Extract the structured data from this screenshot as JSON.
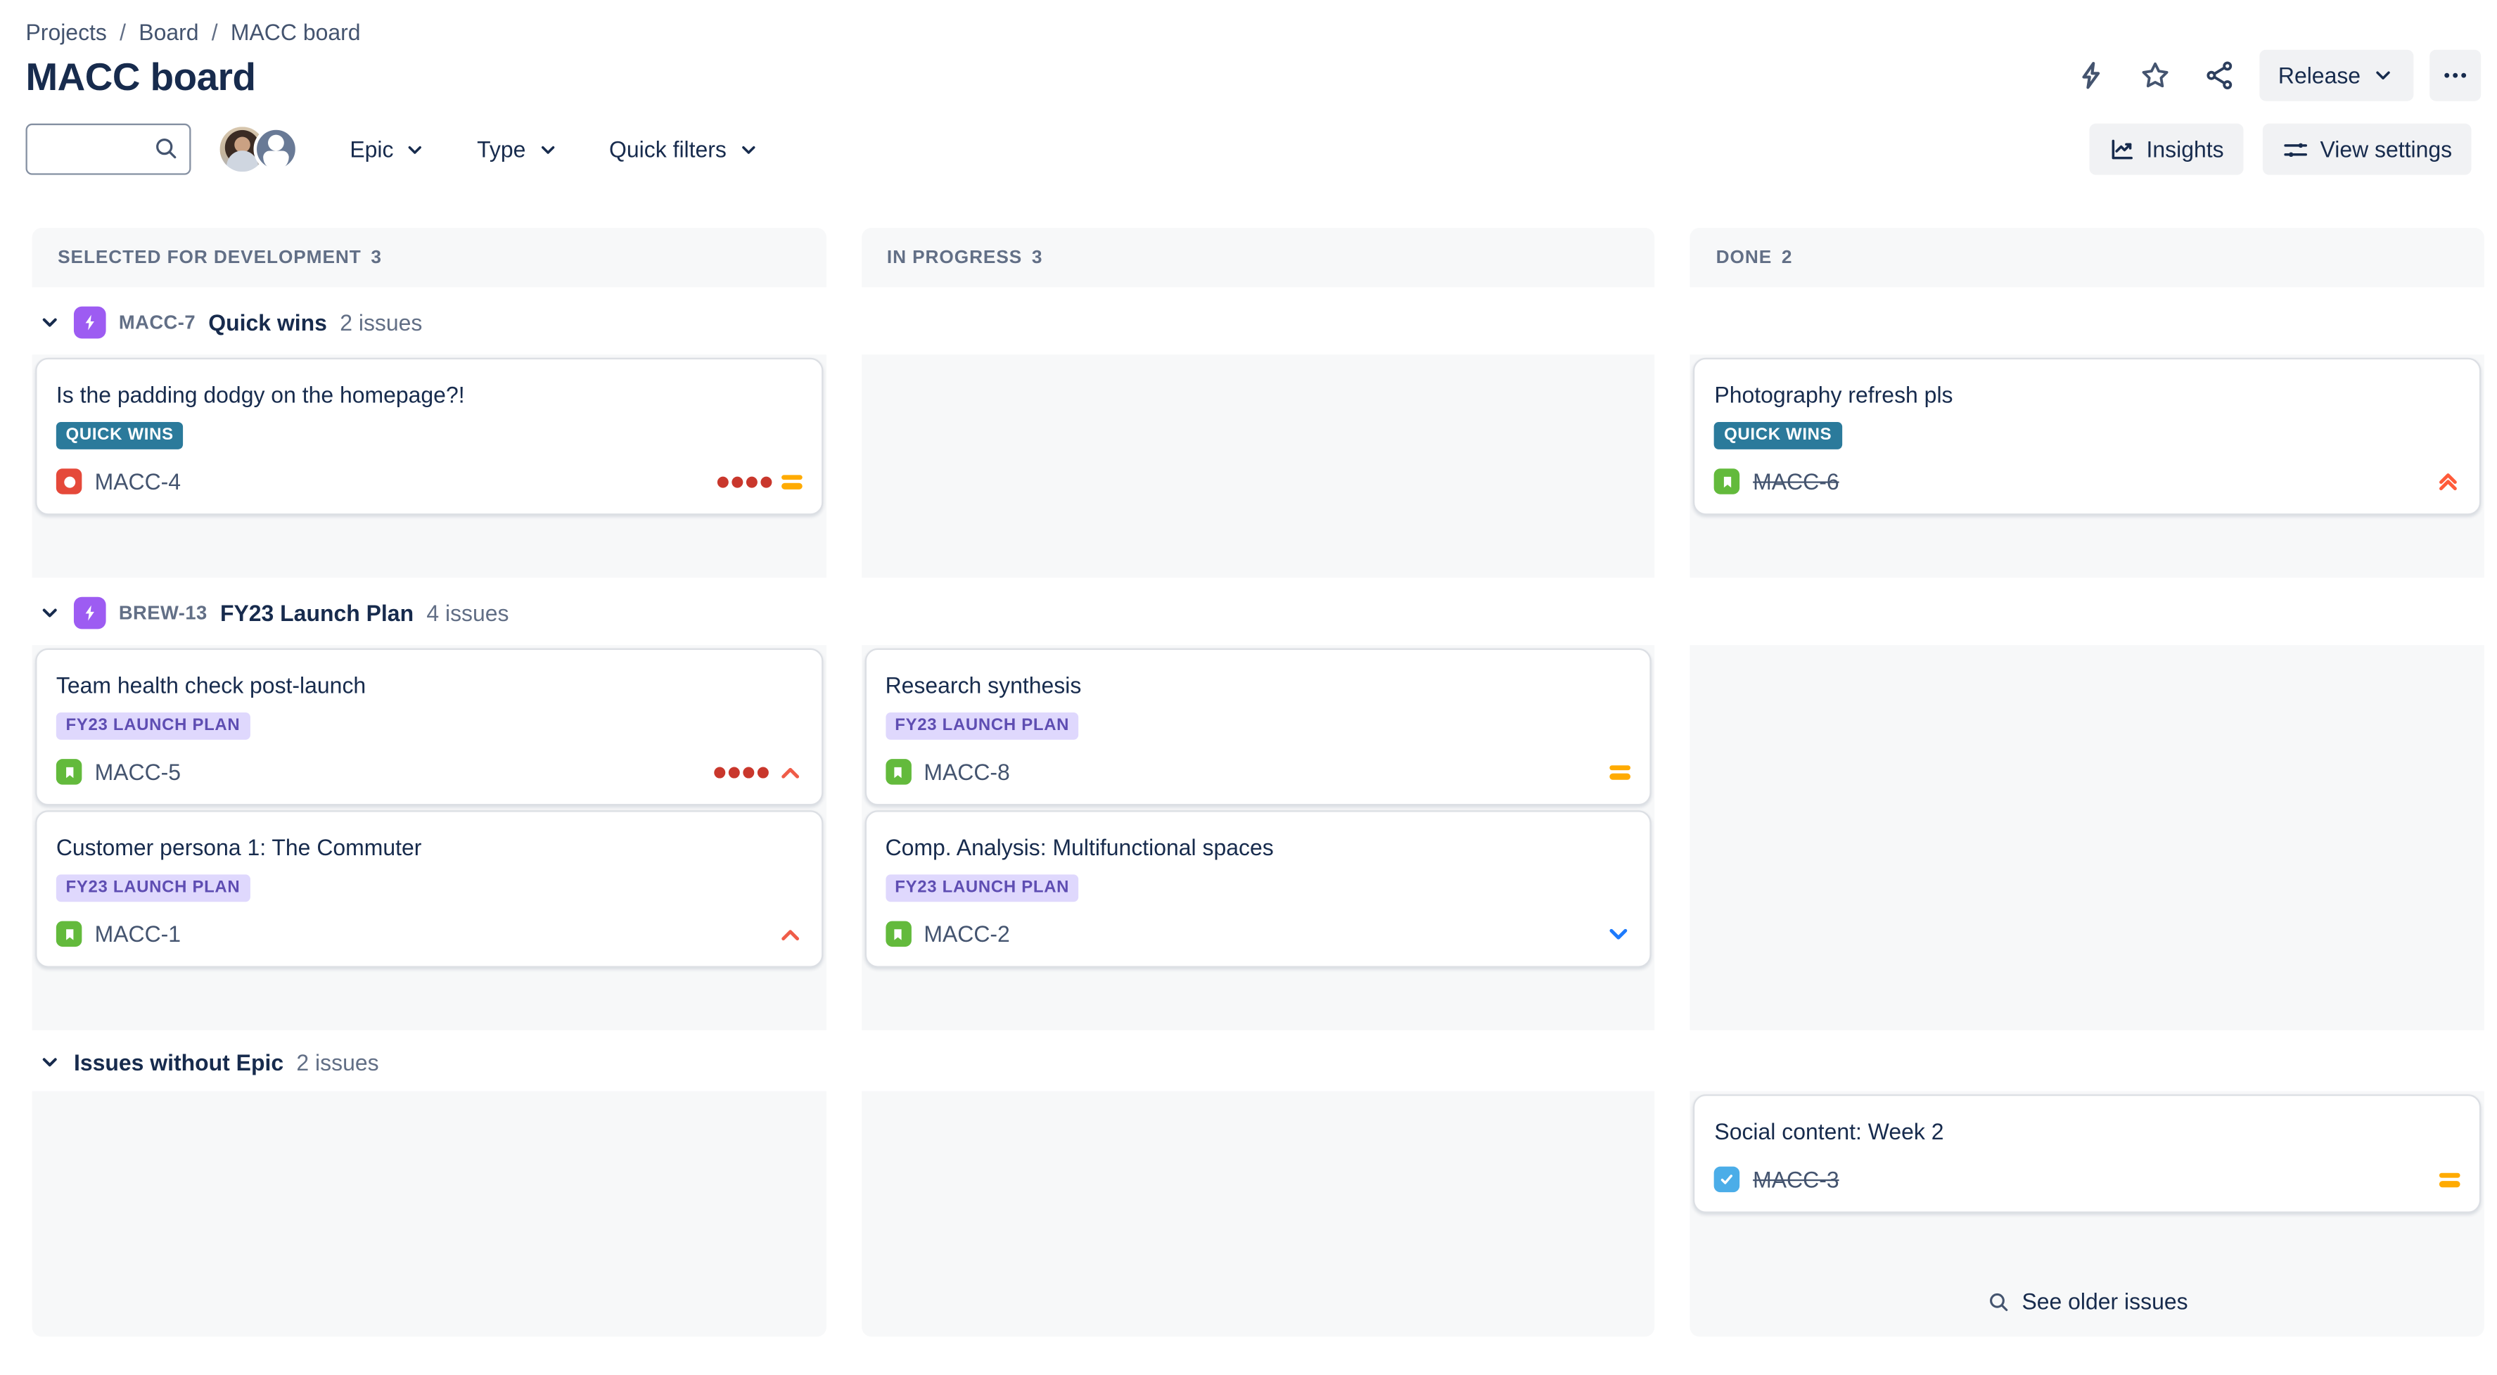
{
  "breadcrumb": {
    "items": [
      "Projects",
      "Board",
      "MACC board"
    ],
    "separator": "/"
  },
  "header": {
    "title": "MACC board",
    "release_label": "Release"
  },
  "toolbar": {
    "search_value": "",
    "epic_filter": "Epic",
    "type_filter": "Type",
    "quick_filters": "Quick filters",
    "insights_label": "Insights",
    "view_settings_label": "View settings"
  },
  "columns": [
    {
      "name": "SELECTED FOR DEVELOPMENT",
      "count": "3"
    },
    {
      "name": "IN PROGRESS",
      "count": "3"
    },
    {
      "name": "DONE",
      "count": "2"
    }
  ],
  "swimlanes": [
    {
      "key": "MACC-7",
      "name": "Quick wins",
      "count": "2 issues"
    },
    {
      "key": "BREW-13",
      "name": "FY23 Launch Plan",
      "count": "4 issues"
    },
    {
      "key": "",
      "name": "Issues without Epic",
      "count": "2 issues"
    }
  ],
  "cards": {
    "macc4": {
      "title": "Is the padding dodgy on the homepage?!",
      "label": "QUICK WINS",
      "key": "MACC-4"
    },
    "macc6": {
      "title": "Photography refresh pls",
      "label": "QUICK WINS",
      "key": "MACC-6"
    },
    "macc5": {
      "title": "Team health check post-launch",
      "label": "FY23 LAUNCH PLAN",
      "key": "MACC-5"
    },
    "macc8": {
      "title": "Research synthesis",
      "label": "FY23 LAUNCH PLAN",
      "key": "MACC-8"
    },
    "macc1": {
      "title": "Customer persona 1: The Commuter",
      "label": "FY23 LAUNCH PLAN",
      "key": "MACC-1"
    },
    "macc2": {
      "title": "Comp. Analysis: Multifunctional spaces",
      "label": "FY23 LAUNCH PLAN",
      "key": "MACC-2"
    },
    "macc3": {
      "title": "Social content: Week 2",
      "key": "MACC-3"
    }
  },
  "footer": {
    "see_older_label": "See older issues"
  },
  "icons": {
    "quick_add": "lightning-bolt",
    "favourite": "star",
    "share": "share-nodes",
    "more": "ellipsis",
    "search": "magnifier",
    "insights": "line-chart",
    "view_settings": "sliders",
    "collapse": "chevron-down",
    "epic": "lightning-bolt",
    "story": "bookmark",
    "bug": "circle",
    "task": "checkmark"
  },
  "colors": {
    "epic": "#9D5CF2",
    "story": "#63BA3C",
    "bug": "#E5493A",
    "task": "#4BADE8",
    "priority_medium": "#FFAB00",
    "priority_high": "#EF5C48",
    "priority_highest": "#FF5B3A",
    "priority_low": "#1D7AFC",
    "dots": "#C9372C",
    "badge_teal": "#2B7A9B",
    "badge_purple_bg": "#DFD8FD",
    "badge_purple_text": "#5E4DB2"
  }
}
